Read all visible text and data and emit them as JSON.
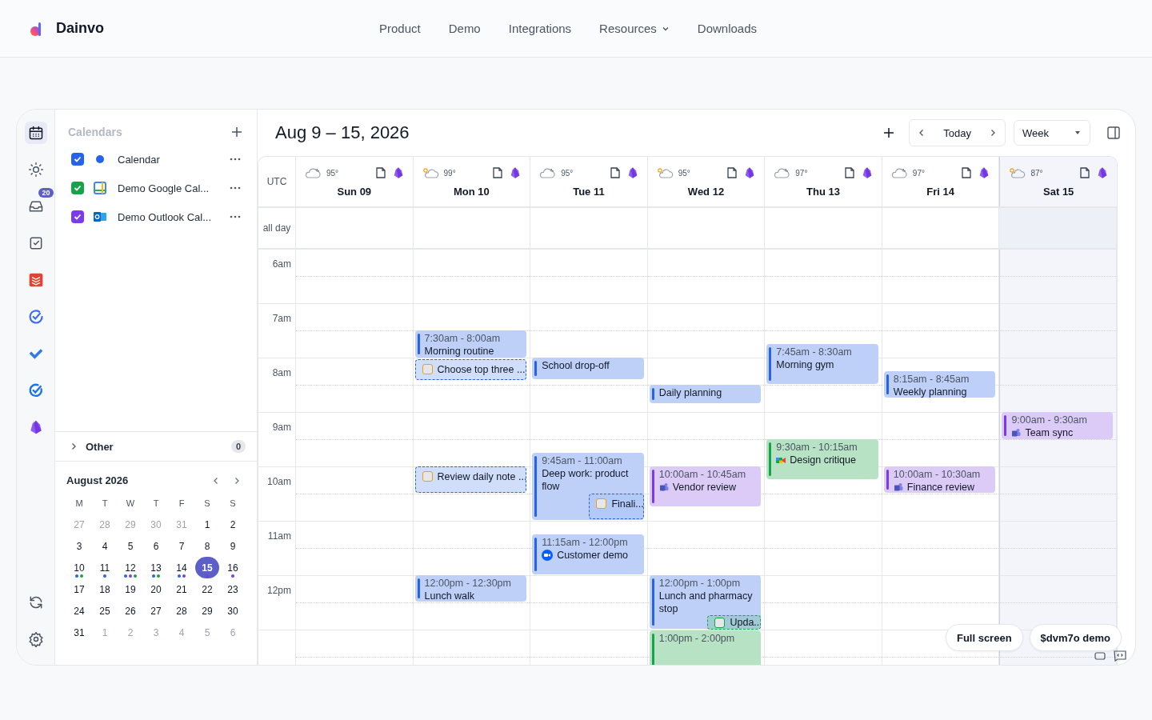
{
  "nav": {
    "brand": "Dainvo",
    "links": [
      {
        "label": "Product",
        "dropdown": false
      },
      {
        "label": "Demo",
        "dropdown": false
      },
      {
        "label": "Integrations",
        "dropdown": false
      },
      {
        "label": "Resources",
        "dropdown": true
      },
      {
        "label": "Downloads",
        "dropdown": false
      }
    ]
  },
  "rail": {
    "items": [
      {
        "kind": "calendar",
        "selected": true
      },
      {
        "kind": "sun",
        "selected": false
      },
      {
        "kind": "inbox",
        "selected": false,
        "badge": "20"
      },
      {
        "kind": "checkbox",
        "selected": false
      },
      {
        "kind": "stack",
        "selected": false
      },
      {
        "kind": "check-circle",
        "selected": false
      },
      {
        "kind": "check",
        "selected": false
      },
      {
        "kind": "target",
        "selected": false
      },
      {
        "kind": "gem",
        "selected": false
      }
    ],
    "bottom": [
      {
        "kind": "sync"
      },
      {
        "kind": "settings"
      }
    ]
  },
  "calendars": {
    "title": "Calendars",
    "items": [
      {
        "name": "Calendar",
        "checked": true,
        "color": "#2563eb",
        "kind": "dot"
      },
      {
        "name": "Demo Google Cal...",
        "checked": true,
        "color": "#16a34a",
        "kind": "google"
      },
      {
        "name": "Demo Outlook Cal...",
        "checked": true,
        "color": "#7c3aed",
        "kind": "outlook"
      }
    ],
    "other": {
      "label": "Other",
      "count": "0",
      "expanded": false
    }
  },
  "mini_calendar": {
    "title": "August 2026",
    "weekdays": [
      "M",
      "T",
      "W",
      "T",
      "F",
      "S",
      "S"
    ],
    "days": [
      {
        "d": "27",
        "outside": true,
        "selected": false
      },
      {
        "d": "28",
        "outside": true,
        "selected": false
      },
      {
        "d": "29",
        "outside": true,
        "selected": false
      },
      {
        "d": "30",
        "outside": true,
        "selected": false
      },
      {
        "d": "31",
        "outside": true,
        "selected": false
      },
      {
        "d": "1",
        "outside": false,
        "selected": false
      },
      {
        "d": "2",
        "outside": false,
        "selected": false
      },
      {
        "d": "3",
        "outside": false,
        "selected": false
      },
      {
        "d": "4",
        "outside": false,
        "selected": false
      },
      {
        "d": "5",
        "outside": false,
        "selected": false
      },
      {
        "d": "6",
        "outside": false,
        "selected": false
      },
      {
        "d": "7",
        "outside": false,
        "selected": false
      },
      {
        "d": "8",
        "outside": false,
        "selected": false
      },
      {
        "d": "9",
        "outside": false,
        "selected": false
      },
      {
        "d": "10",
        "outside": false,
        "selected": false,
        "dots": [
          {
            "color": "#2563eb"
          },
          {
            "color": "#16a34a"
          }
        ]
      },
      {
        "d": "11",
        "outside": false,
        "selected": false,
        "dots": [
          {
            "color": "#2563eb"
          }
        ]
      },
      {
        "d": "12",
        "outside": false,
        "selected": false,
        "dots": [
          {
            "color": "#2563eb"
          },
          {
            "color": "#7c3aed"
          },
          {
            "color": "#16a34a"
          }
        ]
      },
      {
        "d": "13",
        "outside": false,
        "selected": false,
        "dots": [
          {
            "color": "#2563eb"
          },
          {
            "color": "#16a34a"
          }
        ]
      },
      {
        "d": "14",
        "outside": false,
        "selected": false,
        "dots": [
          {
            "color": "#2563eb"
          },
          {
            "color": "#7c3aed"
          }
        ]
      },
      {
        "d": "15",
        "outside": false,
        "selected": true,
        "dots": [
          {
            "color": "#7c3aed"
          }
        ]
      },
      {
        "d": "16",
        "outside": false,
        "selected": false,
        "dots": [
          {
            "color": "#7c3aed"
          }
        ]
      },
      {
        "d": "17",
        "outside": false,
        "selected": false
      },
      {
        "d": "18",
        "outside": false,
        "selected": false
      },
      {
        "d": "19",
        "outside": false,
        "selected": false
      },
      {
        "d": "20",
        "outside": false,
        "selected": false
      },
      {
        "d": "21",
        "outside": false,
        "selected": false
      },
      {
        "d": "22",
        "outside": false,
        "selected": false
      },
      {
        "d": "23",
        "outside": false,
        "selected": false
      },
      {
        "d": "24",
        "outside": false,
        "selected": false
      },
      {
        "d": "25",
        "outside": false,
        "selected": false
      },
      {
        "d": "26",
        "outside": false,
        "selected": false
      },
      {
        "d": "27",
        "outside": false,
        "selected": false
      },
      {
        "d": "28",
        "outside": false,
        "selected": false
      },
      {
        "d": "29",
        "outside": false,
        "selected": false
      },
      {
        "d": "30",
        "outside": false,
        "selected": false
      },
      {
        "d": "31",
        "outside": false,
        "selected": false
      },
      {
        "d": "1",
        "outside": true,
        "selected": false
      },
      {
        "d": "2",
        "outside": true,
        "selected": false
      },
      {
        "d": "3",
        "outside": true,
        "selected": false
      },
      {
        "d": "4",
        "outside": true,
        "selected": false
      },
      {
        "d": "5",
        "outside": true,
        "selected": false
      },
      {
        "d": "6",
        "outside": true,
        "selected": false
      }
    ]
  },
  "header": {
    "title": "Aug 9 – 15, 2026",
    "today": "Today",
    "view": "Week"
  },
  "grid": {
    "timezone": "UTC",
    "all_day": "all day",
    "hours": [
      "6am",
      "7am",
      "8am",
      "9am",
      "10am",
      "11am",
      "12pm"
    ],
    "days": [
      {
        "label": "Sun 09",
        "temp": "95°",
        "weather": {
          "kind": "night"
        },
        "selected": false
      },
      {
        "label": "Mon 10",
        "temp": "99°",
        "weather": {
          "kind": "sun"
        },
        "selected": false,
        "events": [
          {
            "kind": "event",
            "time": "7:30am - 8:00am",
            "title": "Morning routine",
            "color": "#2563eb"
          },
          {
            "kind": "task",
            "title": "Choose top three ...",
            "color": "#2563eb",
            "checkbox": {
              "color": "#f59e0b"
            }
          },
          {
            "kind": "task",
            "title": "Review daily note ...",
            "color": "#2563eb",
            "checkbox": {
              "color": "#f59e0b"
            }
          },
          {
            "kind": "event",
            "time": "12:00pm - 12:30pm",
            "title": "Lunch walk",
            "color": "#2563eb"
          }
        ]
      },
      {
        "label": "Tue 11",
        "temp": "95°",
        "weather": {
          "kind": "night"
        },
        "selected": false,
        "events": [
          {
            "kind": "event",
            "title": "School drop-off",
            "color": "#2563eb"
          },
          {
            "kind": "event",
            "time": "9:45am - 11:00am",
            "title": "Deep work: product flow",
            "color": "#2563eb"
          },
          {
            "kind": "task",
            "title": "Finali...",
            "color": "#2563eb",
            "checkbox": {
              "color": "#f59e0b"
            }
          },
          {
            "kind": "event",
            "time": "11:15am - 12:00pm",
            "title": "Customer demo",
            "color": "#2563eb",
            "conference": {
              "kind": "video"
            }
          }
        ]
      },
      {
        "label": "Wed 12",
        "temp": "95°",
        "weather": {
          "kind": "sun"
        },
        "selected": false,
        "events": [
          {
            "kind": "event",
            "title": "Daily planning",
            "color": "#2563eb"
          },
          {
            "kind": "event",
            "time": "10:00am - 10:45am",
            "title": "Vendor review",
            "color": "#7c3aed",
            "conference": {
              "kind": "chat"
            }
          },
          {
            "kind": "event",
            "time": "12:00pm - 1:00pm",
            "title": "Lunch and pharmacy stop",
            "color": "#2563eb"
          },
          {
            "kind": "task",
            "title": "Upda...",
            "color": "#16a34a",
            "checkbox": {
              "color": "#16a34a"
            }
          },
          {
            "kind": "event",
            "time": "1:00pm - 2:00pm",
            "color": "#16a34a"
          }
        ]
      },
      {
        "label": "Thu 13",
        "temp": "97°",
        "weather": {
          "kind": "night"
        },
        "selected": false,
        "events": [
          {
            "kind": "event",
            "time": "7:45am - 8:30am",
            "title": "Morning gym",
            "color": "#2563eb"
          },
          {
            "kind": "event",
            "time": "9:30am - 10:15am",
            "title": "Design critique",
            "color": "#16a34a",
            "conference": {
              "kind": "camera"
            }
          }
        ]
      },
      {
        "label": "Fri 14",
        "temp": "97°",
        "weather": {
          "kind": "night"
        },
        "selected": false,
        "events": [
          {
            "kind": "event",
            "time": "8:15am - 8:45am",
            "title": "Weekly planning",
            "color": "#2563eb"
          },
          {
            "kind": "event",
            "time": "10:00am - 10:30am",
            "title": "Finance review",
            "color": "#7c3aed",
            "conference": {
              "kind": "chat"
            }
          }
        ]
      },
      {
        "label": "Sat 15",
        "temp": "87°",
        "weather": {
          "kind": "sun"
        },
        "selected": true,
        "events": [
          {
            "kind": "event",
            "time": "9:00am - 9:30am",
            "title": "Team sync",
            "color": "#7c3aed",
            "conference": {
              "kind": "chat"
            }
          }
        ]
      }
    ]
  },
  "floating": {
    "buttons": [
      "Full screen",
      "$dvm7o demo"
    ]
  }
}
